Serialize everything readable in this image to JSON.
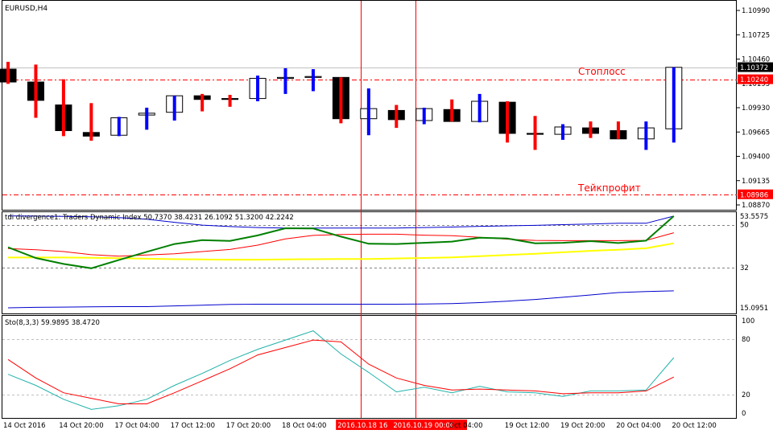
{
  "window": {
    "symbol_label": "EURUSD,H4"
  },
  "price_panel": {
    "price_ticks": [
      "1.10990",
      "1.10725",
      "1.10460",
      "1.10195",
      "1.09930",
      "1.09665",
      "1.09400",
      "1.09135",
      "1.08870"
    ],
    "current_price_tag": "1.10372",
    "stoploss": {
      "label": "Стоплосс",
      "price_tag": "1.10240"
    },
    "takeprofit": {
      "label": "Тейкпрофит",
      "price_tag": "1.08986"
    }
  },
  "tdi_panel": {
    "title": "tdi divergence1: Traders Dynamic Index 50.7370 38.4231 26.1092 51.3200 42.2242",
    "axis_ticks": [
      "53.5575",
      "50",
      "32",
      "15.0951"
    ]
  },
  "sto_panel": {
    "title": "Sto(8,3,3) 59.9895 38.4720",
    "axis_ticks": [
      "100",
      "80",
      "20",
      "0"
    ]
  },
  "time_axis": {
    "labels": [
      "14 Oct 2016",
      "14 Oct 20:00",
      "17 Oct 04:00",
      "17 Oct 12:00",
      "17 Oct 20:00",
      "18 Oct 04:00",
      "2016.10.18 16",
      "2016.10.19 00:00",
      "Oct 04:00",
      "19 Oct 12:00",
      "19 Oct 20:00",
      "20 Oct 04:00",
      "20 Oct 12:00"
    ],
    "highlighted": [
      "2016.10.18 16",
      "2016.10.19 00:00"
    ]
  },
  "colors": {
    "bull_body": "#ffffff",
    "bear_body": "#000000",
    "bull_wick": "#0000ff",
    "bear_wick": "#ff0000",
    "level_line": "#ff0000",
    "vertical_marker": "#ff0000",
    "tdi_volatility": "#0000cd",
    "tdi_rsi": "#008000",
    "tdi_signal": "#ff0000",
    "tdi_market_base": "#ffff00",
    "sto_main": "#20b2aa",
    "sto_signal": "#ff0000"
  },
  "chart_data": [
    {
      "type": "candlestick",
      "symbol": "EURUSD",
      "timeframe": "H4",
      "ylim": [
        1.0887,
        1.1099
      ],
      "candles": [
        {
          "o": 1.1035,
          "h": 1.1043,
          "l": 1.1019,
          "c": 1.1021
        },
        {
          "o": 1.1021,
          "h": 1.104,
          "l": 1.0982,
          "c": 1.1001
        },
        {
          "o": 1.0996,
          "h": 1.1024,
          "l": 1.0962,
          "c": 1.0968
        },
        {
          "o": 1.0966,
          "h": 1.0998,
          "l": 1.0957,
          "c": 1.0962
        },
        {
          "o": 1.0963,
          "h": 1.0983,
          "l": 1.0962,
          "c": 1.0982
        },
        {
          "o": 1.0985,
          "h": 1.0993,
          "l": 1.0969,
          "c": 1.0987
        },
        {
          "o": 1.0988,
          "h": 1.1006,
          "l": 1.0979,
          "c": 1.1006
        },
        {
          "o": 1.1006,
          "h": 1.1008,
          "l": 1.0989,
          "c": 1.1002
        },
        {
          "o": 1.1003,
          "h": 1.1007,
          "l": 1.0994,
          "c": 1.1002
        },
        {
          "o": 1.1003,
          "h": 1.1028,
          "l": 1.1,
          "c": 1.1025
        },
        {
          "o": 1.1025,
          "h": 1.1036,
          "l": 1.1008,
          "c": 1.1026
        },
        {
          "o": 1.1026,
          "h": 1.1035,
          "l": 1.1011,
          "c": 1.1027
        },
        {
          "o": 1.1026,
          "h": 1.1026,
          "l": 1.0976,
          "c": 1.0981
        },
        {
          "o": 1.0981,
          "h": 1.1014,
          "l": 1.0963,
          "c": 1.0992
        },
        {
          "o": 1.099,
          "h": 1.0996,
          "l": 1.0971,
          "c": 1.098
        },
        {
          "o": 1.0979,
          "h": 1.0993,
          "l": 1.0975,
          "c": 1.0992
        },
        {
          "o": 1.0991,
          "h": 1.1002,
          "l": 1.0978,
          "c": 1.0978
        },
        {
          "o": 1.0978,
          "h": 1.1008,
          "l": 1.0977,
          "c": 1.1
        },
        {
          "o": 1.0999,
          "h": 1.1,
          "l": 1.0955,
          "c": 1.0965
        },
        {
          "o": 1.0965,
          "h": 1.0984,
          "l": 1.0947,
          "c": 1.0964
        },
        {
          "o": 1.0964,
          "h": 1.0975,
          "l": 1.0958,
          "c": 1.0972
        },
        {
          "o": 1.0971,
          "h": 1.0978,
          "l": 1.096,
          "c": 1.0965
        },
        {
          "o": 1.0968,
          "h": 1.0978,
          "l": 1.0959,
          "c": 1.0959
        },
        {
          "o": 1.0959,
          "h": 1.0978,
          "l": 1.0947,
          "c": 1.0971
        },
        {
          "o": 1.097,
          "h": 1.1037,
          "l": 1.0955,
          "c": 1.1037
        }
      ],
      "levels": [
        {
          "name": "Стоплосс",
          "value": 1.1024
        },
        {
          "name": "Тейкпрофит",
          "value": 1.08986
        },
        {
          "name": "current",
          "value": 1.10372
        }
      ],
      "vertical_markers_at_candle": [
        12.7,
        14.7
      ]
    },
    {
      "type": "line",
      "title": "tdi divergence1: Traders Dynamic Index 50.7370 38.4231 26.1092 51.3200 42.2242",
      "ylim": [
        15.0951,
        53.5575
      ],
      "reference_lines": [
        50,
        32
      ],
      "series": [
        {
          "name": "Volatility Band Upper",
          "values": [
            53.7,
            53.6,
            53.5,
            53.3,
            53.0,
            52.3,
            51.0,
            49.8,
            49.2,
            48.8,
            48.6,
            48.6,
            48.6,
            48.6,
            48.6,
            48.8,
            49.0,
            49.3,
            49.5,
            49.7,
            50.0,
            50.3,
            50.6,
            50.6,
            53.6
          ]
        },
        {
          "name": "Volatility Band Lower",
          "values": [
            15.1,
            15.3,
            15.4,
            15.5,
            15.6,
            15.6,
            15.9,
            16.2,
            16.5,
            16.6,
            16.6,
            16.6,
            16.6,
            16.6,
            16.6,
            16.7,
            16.9,
            17.3,
            17.9,
            18.6,
            19.5,
            20.5,
            21.5,
            21.9,
            22.2
          ]
        },
        {
          "name": "RSI Price Line",
          "values": [
            40.5,
            36.0,
            33.5,
            31.7,
            35.2,
            38.6,
            41.9,
            43.5,
            43.2,
            45.5,
            48.5,
            48.4,
            45.0,
            42.0,
            41.9,
            42.4,
            42.9,
            44.5,
            44.2,
            42.2,
            42.4,
            43.1,
            42.3,
            43.3,
            53.6
          ]
        },
        {
          "name": "Trade Signal Line",
          "values": [
            40.0,
            39.5,
            38.7,
            37.4,
            36.8,
            37.3,
            37.8,
            38.7,
            39.6,
            41.4,
            44.0,
            45.5,
            45.9,
            46.0,
            46.0,
            45.6,
            45.4,
            44.7,
            43.9,
            43.4,
            43.3,
            43.3,
            43.3,
            43.4,
            46.6
          ]
        },
        {
          "name": "Market Base Line",
          "values": [
            36.2,
            36.2,
            36.2,
            36.1,
            35.9,
            35.7,
            35.5,
            35.4,
            35.3,
            35.3,
            35.4,
            35.5,
            35.6,
            35.6,
            35.8,
            36.0,
            36.3,
            36.8,
            37.3,
            37.8,
            38.4,
            39.0,
            39.5,
            40.1,
            42.2
          ]
        }
      ]
    },
    {
      "type": "line",
      "title": "Sto(8,3,3) 59.9895 38.4720",
      "ylim": [
        0,
        100
      ],
      "reference_lines": [
        80,
        20
      ],
      "series": [
        {
          "name": "%K",
          "values": [
            42,
            30,
            15,
            4,
            8,
            15,
            30,
            43,
            57,
            69,
            79,
            89,
            64,
            44,
            23,
            28,
            22,
            29,
            23,
            22,
            18,
            24,
            24,
            25,
            60
          ]
        },
        {
          "name": "%D",
          "values": [
            58,
            38,
            22,
            16,
            10,
            10,
            22,
            35,
            48,
            63,
            71,
            79,
            77,
            53,
            38,
            30,
            25,
            26,
            25,
            24,
            21,
            22,
            22,
            24,
            39
          ]
        }
      ]
    }
  ]
}
